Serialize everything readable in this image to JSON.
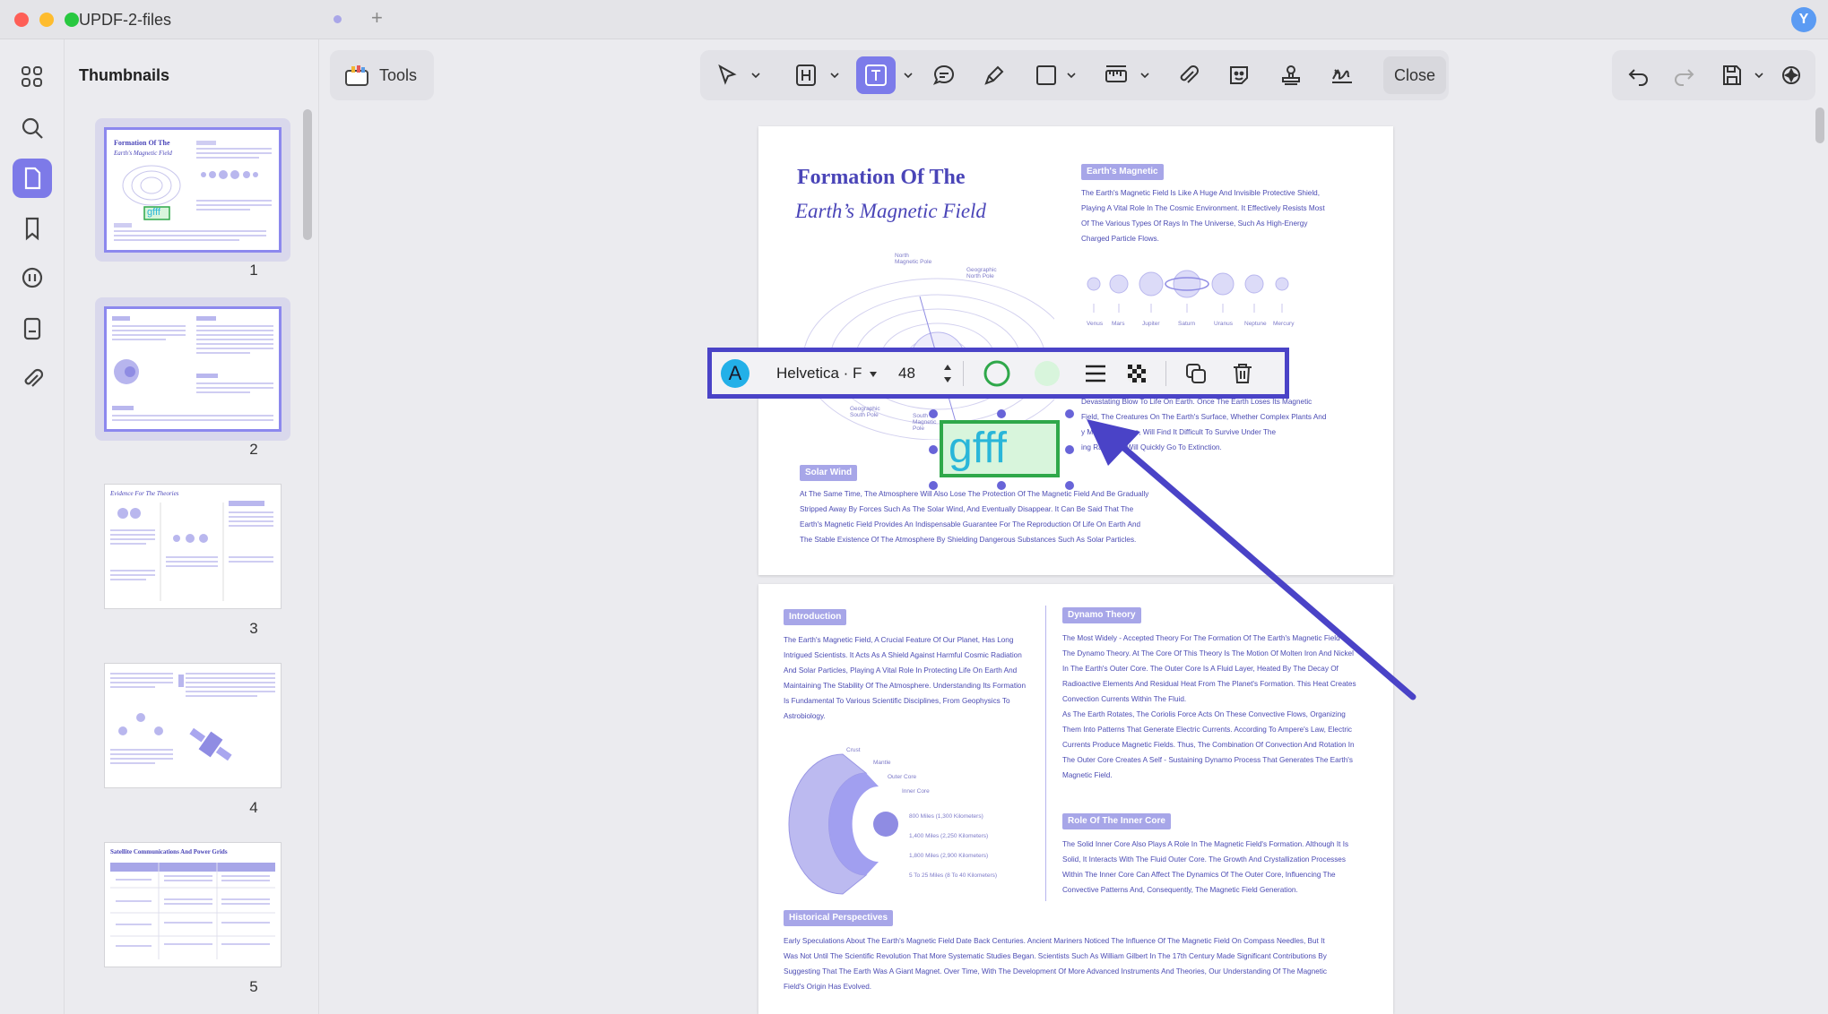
{
  "window": {
    "tab_title": "UPDF-2-files",
    "avatar_letter": "Y"
  },
  "sidebar": {
    "title": "Thumbnails",
    "rail_icons": [
      "grid-icon",
      "search-icon",
      "page-icon",
      "bookmark-icon",
      "comment-icon",
      "form-icon",
      "attachment-icon"
    ],
    "thumbnails": [
      {
        "page": "1",
        "heading": "Formation Of The",
        "sub": "Earth's Magnetic Field",
        "stamp": "gfff"
      },
      {
        "page": "2"
      },
      {
        "page": "3",
        "heading": "Evidence For The Theories"
      },
      {
        "page": "4"
      },
      {
        "page": "5",
        "heading": "Satellite Communications And Power Grids"
      }
    ]
  },
  "toolbar": {
    "tools_label": "Tools",
    "close_label": "Close"
  },
  "format_bar": {
    "color_letter": "A",
    "font": "Helvetica · F",
    "size": "48",
    "text_color": "#23b0e8",
    "border_color": "#2fa84a",
    "fill_color": "#d8f5dc"
  },
  "page1": {
    "title_line1": "Formation Of The",
    "title_line2": "Earth’s Magnetic Field",
    "earth_tag": "Earth's Magnetic",
    "earth_para": [
      "The Earth's Magnetic Field Is Like A Huge And Invisible Protective Shield,",
      "Playing A Vital Role In The Cosmic Environment. It Effectively Resists Most",
      "Of The Various Types Of Rays In The Universe, Such As High-Energy",
      "Charged Particle Flows."
    ],
    "planet_labels": [
      "Venus",
      "Mars",
      "Jupiter",
      "Saturn",
      "Uranus",
      "Neptune",
      "Mercury"
    ],
    "diag_north_mag": "North\nMagnetic Pole",
    "diag_geo_north": "Geographic\nNorth Pole",
    "diag_geo_south": "Geographic\nSouth Pole",
    "diag_south_mag": "South\nMagnetic\nPole",
    "right_para": [
      "Devastating Blow To Life On Earth. Once The Earth Loses Its Magnetic",
      "Field, The Creatures On The Earth's Surface, Whether Complex Plants And",
      "y Microorganisms, Will Find It Difficult To Survive Under The",
      "ing Rays And Will Quickly Go To Extinction."
    ],
    "textbox_text": "gfff",
    "solar_tag": "Solar Wind",
    "solar_para": [
      "At The Same Time, The Atmosphere Will Also Lose The Protection Of The Magnetic Field And Be Gradually",
      "Stripped Away By Forces Such As The Solar Wind, And Eventually Disappear. It Can Be Said That The",
      "Earth's Magnetic Field Provides An Indispensable Guarantee For The Reproduction Of Life On Earth And",
      "The Stable Existence Of The Atmosphere By Shielding Dangerous Substances Such As Solar Particles."
    ]
  },
  "page2": {
    "intro_tag": "Introduction",
    "intro_para": [
      "The Earth's Magnetic Field, A Crucial Feature Of Our Planet, Has Long",
      "Intrigued Scientists. It Acts As A Shield Against Harmful Cosmic Radiation",
      "And Solar Particles, Playing A Vital Role In Protecting Life On Earth And",
      "Maintaining The Stability Of The Atmosphere. Understanding Its Formation",
      "Is Fundamental To Various Scientific Disciplines, From Geophysics To",
      "Astrobiology."
    ],
    "layer_labels": [
      "Crust",
      "Mantle",
      "Outer Core",
      "Inner Core"
    ],
    "depth_labels": [
      "800 Miles (1,300 Kilometers)",
      "1,400 Miles (2,250 Kilometers)",
      "1,800 Miles (2,900 Kilometers)",
      "5 To 25 Miles (8 To 40 Kilometers)"
    ],
    "dynamo_tag": "Dynamo Theory",
    "dynamo_para": [
      "The Most Widely - Accepted Theory For The Formation Of The Earth's Magnetic Field Is",
      "The Dynamo Theory. At The Core Of This Theory Is The Motion Of Molten Iron And Nickel",
      "In The Earth's Outer Core. The Outer Core Is A Fluid Layer, Heated By The Decay Of",
      "Radioactive Elements And Residual Heat From The Planet's Formation. This Heat Creates",
      "Convection Currents Within The Fluid.",
      "As The Earth Rotates, The Coriolis Force Acts On These Convective Flows, Organizing",
      "Them Into Patterns That Generate Electric Currents. According To Ampere's Law, Electric",
      "Currents Produce Magnetic Fields. Thus, The Combination Of Convection And Rotation In",
      "The Outer Core Creates A Self - Sustaining Dynamo Process That Generates The Earth's",
      "Magnetic Field."
    ],
    "inner_tag": "Role Of The Inner Core",
    "inner_para": [
      "The Solid Inner Core Also Plays A Role In The Magnetic Field's Formation. Although It Is",
      "Solid, It Interacts With The Fluid Outer Core. The Growth And Crystallization Processes",
      "Within The Inner Core Can Affect The Dynamics Of The Outer Core, Influencing The",
      "Convective Patterns And, Consequently, The Magnetic Field Generation."
    ],
    "hist_tag": "Historical Perspectives",
    "hist_para": [
      "Early Speculations About The Earth's Magnetic Field Date Back Centuries. Ancient Mariners Noticed The Influence Of The Magnetic Field On Compass Needles, But It",
      "Was Not Until The Scientific Revolution That More Systematic Studies Began. Scientists Such As William Gilbert In The 17th Century Made Significant Contributions By",
      "Suggesting That The Earth Was A Giant Magnet. Over Time, With The Development Of More Advanced Instruments And Theories, Our Understanding Of The Magnetic",
      "Field's Origin Has Evolved."
    ]
  },
  "colors": {
    "accent": "#7d7ae8",
    "annotation_arrow": "#4a43c7",
    "doc_text": "#4b4bb3"
  }
}
